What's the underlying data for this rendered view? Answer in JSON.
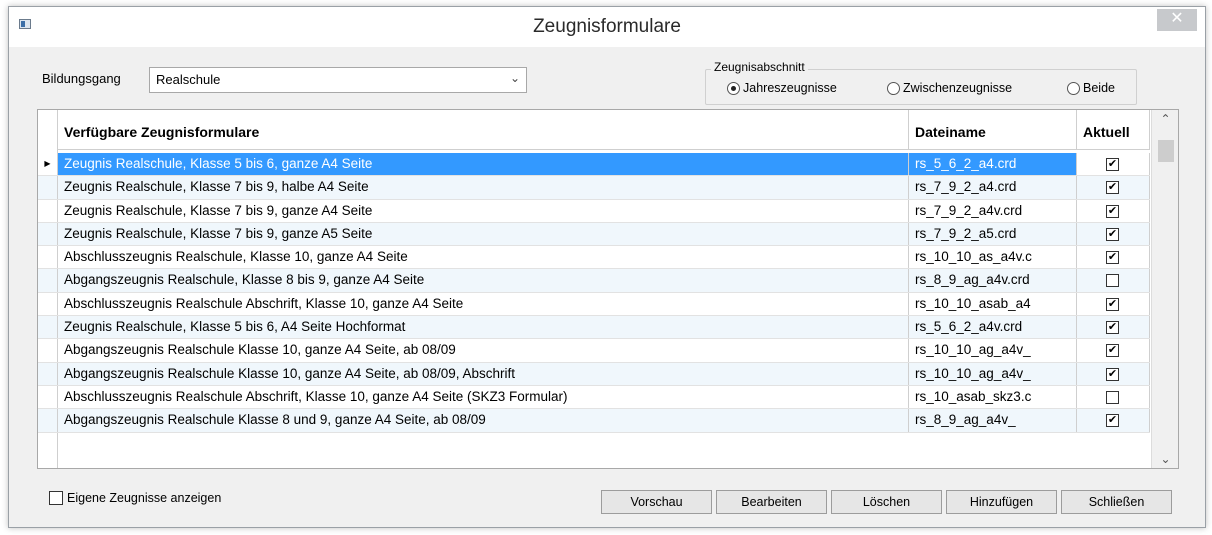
{
  "window": {
    "title": "Zeugnisformulare",
    "close_glyph": "✕"
  },
  "bildungsgang": {
    "label": "Bildungsgang",
    "value": "Realschule"
  },
  "abschnitt": {
    "legend": "Zeugnisabschnitt",
    "options": [
      {
        "label": "Jahreszeugnisse",
        "selected": true
      },
      {
        "label": "Zwischenzeugnisse",
        "selected": false
      },
      {
        "label": "Beide",
        "selected": false
      }
    ]
  },
  "table": {
    "headers": [
      "Verfügbare Zeugnisformulare",
      "Dateiname",
      "Aktuell"
    ],
    "rows": [
      {
        "name": "Zeugnis Realschule, Klasse 5 bis 6, ganze A4 Seite",
        "file": "rs_5_6_2_a4.crd",
        "aktuell": true
      },
      {
        "name": "Zeugnis Realschule, Klasse 7 bis 9, halbe A4 Seite",
        "file": "rs_7_9_2_a4.crd",
        "aktuell": true
      },
      {
        "name": "Zeugnis Realschule, Klasse 7 bis 9, ganze A4 Seite",
        "file": "rs_7_9_2_a4v.crd",
        "aktuell": true
      },
      {
        "name": "Zeugnis Realschule, Klasse 7 bis 9, ganze A5 Seite",
        "file": "rs_7_9_2_a5.crd",
        "aktuell": true
      },
      {
        "name": "Abschlusszeugnis Realschule, Klasse 10, ganze A4 Seite",
        "file": "rs_10_10_as_a4v.c",
        "aktuell": true
      },
      {
        "name": "Abgangszeugnis Realschule, Klasse 8 bis 9, ganze A4 Seite",
        "file": "rs_8_9_ag_a4v.crd",
        "aktuell": false
      },
      {
        "name": "Abschlusszeugnis Realschule Abschrift, Klasse 10, ganze A4 Seite",
        "file": "rs_10_10_asab_a4",
        "aktuell": true
      },
      {
        "name": "Zeugnis Realschule, Klasse 5 bis 6, A4 Seite Hochformat",
        "file": "rs_5_6_2_a4v.crd",
        "aktuell": true
      },
      {
        "name": "Abgangszeugnis Realschule Klasse 10, ganze A4 Seite, ab 08/09",
        "file": "rs_10_10_ag_a4v_",
        "aktuell": true
      },
      {
        "name": "Abgangszeugnis Realschule Klasse 10, ganze A4 Seite, ab 08/09, Abschrift",
        "file": "rs_10_10_ag_a4v_",
        "aktuell": true
      },
      {
        "name": "Abschlusszeugnis Realschule Abschrift, Klasse 10, ganze A4 Seite (SKZ3 Formular)",
        "file": "rs_10_asab_skz3.c",
        "aktuell": false
      },
      {
        "name": "Abgangszeugnis Realschule Klasse 8 und 9, ganze A4 Seite, ab 08/09",
        "file": "rs_8_9_ag_a4v_",
        "aktuell": true
      }
    ]
  },
  "eigene": {
    "label": "Eigene Zeugnisse anzeigen",
    "checked": false
  },
  "buttons": {
    "vorschau": "Vorschau",
    "bearbeiten": "Bearbeiten",
    "loeschen": "Löschen",
    "hinzufuegen": "Hinzufügen",
    "schliessen": "Schließen"
  },
  "colors": {
    "selection": "#3399ff",
    "alt_row": "#f0f7fc"
  }
}
